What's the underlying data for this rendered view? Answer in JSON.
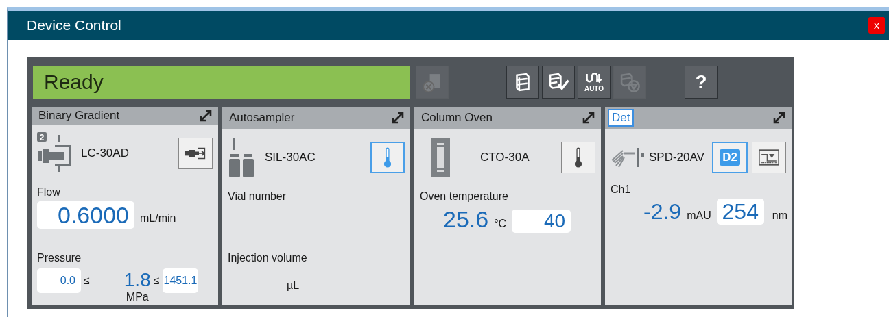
{
  "window": {
    "title": "Device Control",
    "close_label": "X"
  },
  "status": {
    "text": "Ready"
  },
  "toolbar": {
    "left": [
      {
        "kind": "cancel",
        "disabled": true
      }
    ],
    "middle": [
      {
        "kind": "stack",
        "disabled": false
      },
      {
        "kind": "stack-check",
        "disabled": false
      },
      {
        "kind": "auto",
        "label": "AUTO",
        "disabled": false
      },
      {
        "kind": "stack-stop",
        "disabled": true
      }
    ],
    "right": [
      {
        "kind": "help",
        "label": "?",
        "disabled": false
      }
    ]
  },
  "modules": [
    {
      "kind": "pump",
      "title": "Binary Gradient",
      "selected": false,
      "model": "LC-30AD",
      "pump_count": "2",
      "tool": {
        "selected": false
      },
      "flow_label": "Flow",
      "flow_value": "0.6000",
      "flow_unit": "mL/min",
      "pressure_label": "Pressure",
      "pressure_min": "0.0",
      "le_1": "≤",
      "pressure_value": "1.8",
      "le_2": "≤",
      "pressure_max": "1451.1",
      "pressure_unit": "MPa"
    },
    {
      "kind": "autosampler",
      "title": "Autosampler",
      "selected": false,
      "model": "SIL-30AC",
      "tool": {
        "selected": true
      },
      "vial_label": "Vial number",
      "injection_label": "Injection volume",
      "injection_unit": "µL"
    },
    {
      "kind": "oven",
      "title": "Column Oven",
      "selected": false,
      "model": "CTO-30A",
      "tool": {
        "selected": false
      },
      "temp_label": "Oven temperature",
      "temp_value": "25.6",
      "temp_unit": "°C",
      "temp_setpoint": "40"
    },
    {
      "kind": "detector",
      "title": "Det",
      "selected": true,
      "model": "SPD-20AV",
      "lamp": {
        "label": "D2",
        "on": true
      },
      "tool": {
        "selected": false
      },
      "channel": "Ch1",
      "absorbance": "-2.9",
      "abs_unit": "mAU",
      "wavelength": "254",
      "wl_unit": "nm"
    }
  ]
}
